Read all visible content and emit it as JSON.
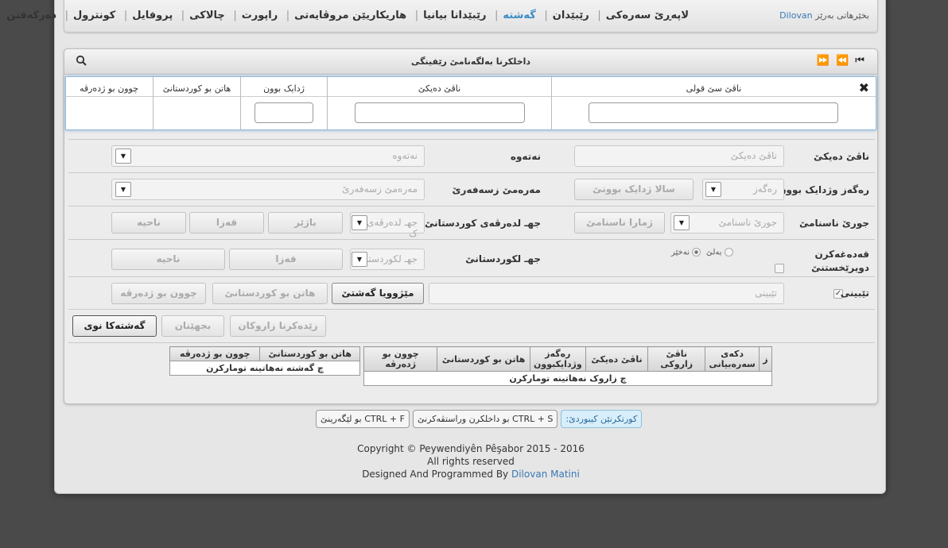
{
  "header": {
    "welcome_label": "بخێرهاتی بەرێز",
    "username": "Dilovan",
    "menu": [
      {
        "label": "لاپەڕێ سەرەکی",
        "active": false
      },
      {
        "label": "رێبێدان",
        "active": false
      },
      {
        "label": "گەشتە",
        "active": true
      },
      {
        "label": "رێبێدانا بیانیا",
        "active": false
      },
      {
        "label": "هاریکاریێن مروڤایەتی",
        "active": false
      },
      {
        "label": "راپورت",
        "active": false
      },
      {
        "label": "چالاکی",
        "active": false
      },
      {
        "label": "پروفایل",
        "active": false
      },
      {
        "label": "کونترول",
        "active": false
      },
      {
        "label": "دەرکەفتن",
        "active": false
      }
    ]
  },
  "panel": {
    "title": "داخلکرنا بەلگەنامێ رێفینگی",
    "pager": {
      "first": "⏮",
      "prev": "⏪",
      "next": "⏩",
      "last": "⏭"
    }
  },
  "filter": {
    "columns": [
      "ناڤێ سێ قولی",
      "ناڤێ دەیکێ",
      "ژدایک بوون",
      "هاتن بو کوردستانێ",
      "چوون بو ژدەرڤە"
    ]
  },
  "form": {
    "mother_label": "ناڤێ دەیکێ",
    "mother_placeholder": "ناڤێ دەیکێ",
    "nation_label": "نەتەوە",
    "nation_placeholder": "نەتەوە",
    "birth_label": "رەگەز وژدایک بوون",
    "gender_placeholder": "رەگەز",
    "birthyear_placeholder": "سالا ژدایک بوونێ",
    "status_label": "مەرەمێ زسەفەرێ",
    "status_placeholder": "مەرەمێ زسەفەرێ",
    "id_label": "جورێ ناسنامێ",
    "id_type_placeholder": "جورێ ناسنامێ",
    "id_number_placeholder": "ژمارا ناسنامێ",
    "abroad_label": "جهـ لدەرڤەی کوردستانێ",
    "abroad_place": "جهـ لدەرڤەی ک",
    "abroad_city": "باژێر",
    "abroad_district": "قەزا",
    "abroad_area": "ناحیە",
    "deport_label": "قەدەغەکرن دویرێخستنێ",
    "deport_yes": "بەلێ",
    "deport_no": "نەخێر",
    "kurd_label": "جهـ لکوردستانێ",
    "kurd_place": "جهـ لکوردستان",
    "kurd_district": "قەزا",
    "kurd_area": "ناحیە",
    "note_label": "تێبینی",
    "note_placeholder": "تێبینی",
    "history_button": "مێژوویا گەشتێ",
    "arrive_button": "هاتن بو کوردستانێ",
    "leave_button": "چوون بو ژدەرڤە"
  },
  "actions": {
    "new_trip": "گەشتەکا نوی",
    "add_children": "زێدەکرنا زاروکان",
    "cancel": "بجهێنان"
  },
  "children_table": {
    "headers": [
      "ز",
      "دکەی سەرەبیانی",
      "ناڤێ زاروکی",
      "ناڤێ دەیکێ",
      "رەگەز وژدایکبوون",
      "هاتن بو کوردستانێ",
      "چوون بو ژدەرڤە"
    ],
    "empty": "چ زاروک نەهاتینە تومارکرن"
  },
  "trips_table": {
    "headers": [
      "هاتن بو کوردستانێ",
      "چوون بو ژدەرڤە"
    ],
    "empty": "چ گەشتە نەهاتینە تومارکرن"
  },
  "shortcuts": {
    "title": "کورتکرنێن کیبوردێ:",
    "save": "CTRL + S بو داخلکرن وراستڤەکرنێ",
    "search": "CTRL + F بو لێگەرینێ"
  },
  "footer": {
    "copyright": "Copyright © Peywendiyên Pêşabor 2015 - 2016",
    "rights": "All rights reserved",
    "designed": "Designed And Programmed By",
    "author": "Dilovan Matini"
  }
}
